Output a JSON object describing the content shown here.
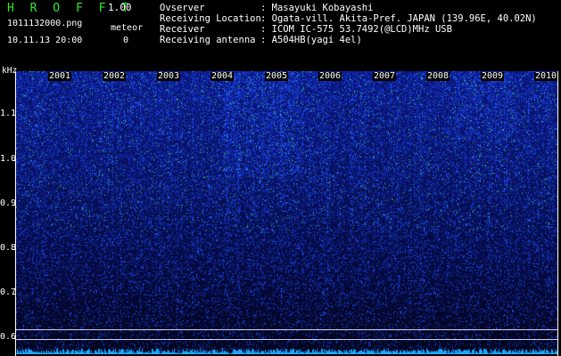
{
  "header": {
    "app_title": "H R O F F T",
    "app_version": "1.00",
    "file_name": "1011132000.png",
    "date_time": "10.11.13 20:00",
    "meteor_label": "meteor",
    "meteor_count": "0"
  },
  "info": [
    {
      "label": "Ovserver",
      "value": ": Masayuki Kobayashi"
    },
    {
      "label": "Receiving Location",
      "value": ": Ogata-vill. Akita-Pref. JAPAN (139.96E, 40.02N)"
    },
    {
      "label": "Receiver",
      "value": ": ICOM IC-575 53.7492(@LCD)MHz USB"
    },
    {
      "label": "Receiving antenna",
      "value": ": A504HB(yagi 4el)"
    }
  ],
  "chart": {
    "y_unit": "kHz",
    "y_ticks": [
      "1.1",
      "1.0",
      "0.9",
      "0.8",
      "0.7",
      "0.6"
    ],
    "year_labels": [
      "2001",
      "2002",
      "2003",
      "2004",
      "2005",
      "2006",
      "2007",
      "2008",
      "2009",
      "2010"
    ]
  },
  "colors": {
    "title": "#2ee82e",
    "background": "#000000",
    "spectrum_low": "#050a40",
    "spectrum_mid": "#1f4cff",
    "spectrum_high": "#40e0a0"
  }
}
